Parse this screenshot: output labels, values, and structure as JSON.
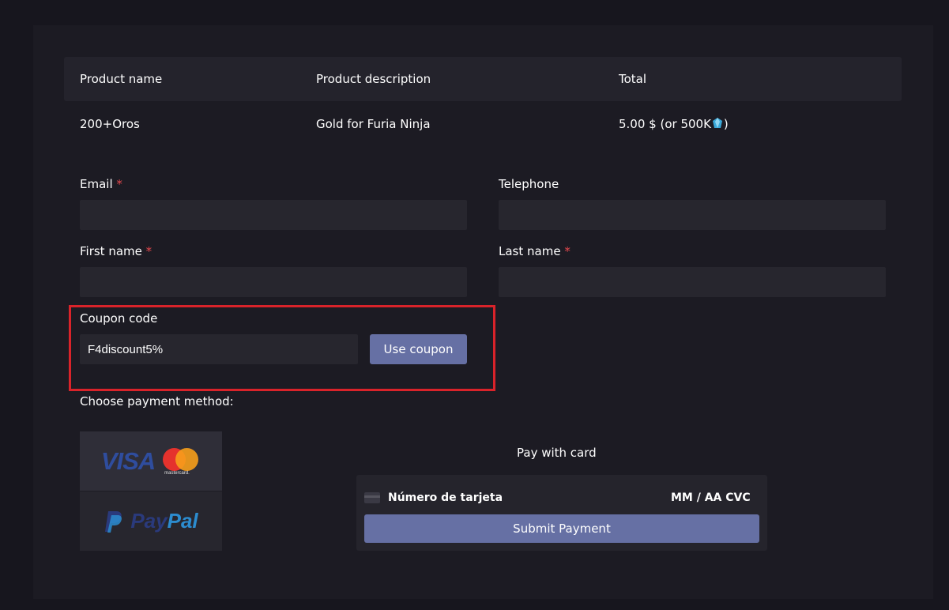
{
  "table": {
    "headers": {
      "name": "Product name",
      "description": "Product description",
      "total": "Total"
    },
    "row": {
      "name": "200+Oros",
      "description": "Gold for Furia Ninja",
      "total": "5.00 $  (or 500K",
      "total_suffix": ")"
    }
  },
  "form": {
    "email_label": "Email",
    "telephone_label": "Telephone",
    "first_name_label": "First name",
    "last_name_label": "Last name",
    "required_mark": "*",
    "email_value": "",
    "telephone_value": "",
    "first_name_value": "",
    "last_name_value": ""
  },
  "coupon": {
    "label": "Coupon code",
    "value": "F4discount5%",
    "button": "Use coupon"
  },
  "payment": {
    "label": "Choose payment method:",
    "visa_text": "VISA",
    "mastercard_text": "mastercard.",
    "paypal_pay": "Pay",
    "paypal_pal": "Pal",
    "card_title": "Pay with card",
    "card_number_placeholder": "Número de tarjeta",
    "expiry_cvc": "MM / AA  CVC",
    "submit": "Submit Payment"
  },
  "colors": {
    "background": "#17161e",
    "panel": "#1c1b23",
    "accent_button": "#6670a4",
    "required": "#e5484d",
    "highlight_border": "#d9232a"
  }
}
